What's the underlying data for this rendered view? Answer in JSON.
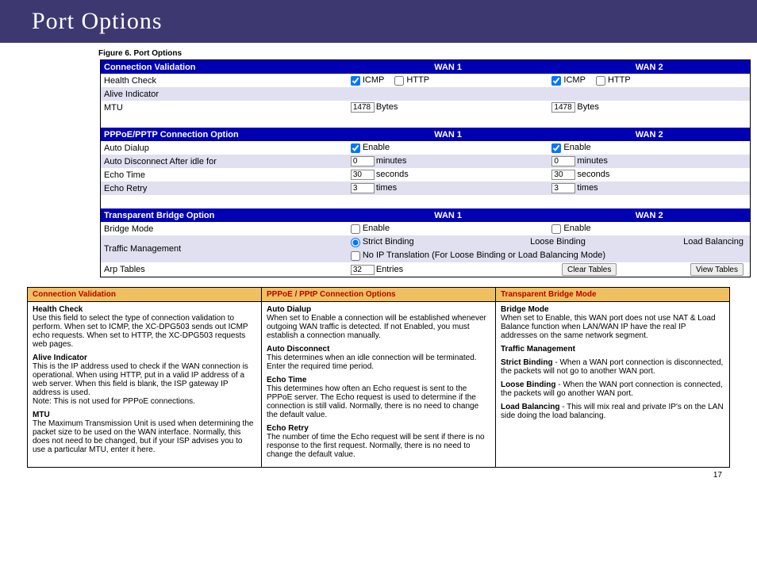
{
  "header": {
    "title": "Port Options"
  },
  "figure_caption": "Figure 6.  Port Options",
  "section1": {
    "title": "Connection Validation",
    "wan1": "WAN 1",
    "wan2": "WAN 2",
    "rows": {
      "health_check": {
        "label": "Health Check",
        "icmp": "ICMP",
        "http": "HTTP",
        "icmp_checked": true,
        "http_checked": false
      },
      "alive_indicator": {
        "label": "Alive Indicator"
      },
      "mtu": {
        "label": "MTU",
        "value": "1478",
        "unit": "Bytes"
      }
    }
  },
  "section2": {
    "title": "PPPoE/PPTP Connection Option",
    "wan1": "WAN 1",
    "wan2": "WAN 2",
    "rows": {
      "auto_dialup": {
        "label": "Auto Dialup",
        "enable": "Enable",
        "checked": true
      },
      "auto_disconnect": {
        "label": "Auto Disconnect After idle for",
        "value": "0",
        "unit": "minutes"
      },
      "echo_time": {
        "label": "Echo Time",
        "value": "30",
        "unit": "seconds"
      },
      "echo_retry": {
        "label": "Echo Retry",
        "value": "3",
        "unit": "times"
      }
    }
  },
  "section3": {
    "title": "Transparent Bridge Option",
    "wan1": "WAN 1",
    "wan2": "WAN 2",
    "rows": {
      "bridge_mode": {
        "label": "Bridge Mode",
        "enable": "Enable",
        "checked": false
      },
      "traffic_mgmt": {
        "label": "Traffic Management",
        "strict": "Strict Binding",
        "loose": "Loose Binding",
        "balance": "Load Balancing",
        "noip": "No IP Translation (For Loose Binding or Load Balancing Mode)",
        "noip_checked": false
      },
      "arp_tables": {
        "label": "Arp Tables",
        "value": "32",
        "unit": "Entries",
        "clear_btn": "Clear Tables",
        "view_btn": "View Tables"
      }
    }
  },
  "descriptions": {
    "col1": {
      "head": "Connection Validation",
      "health_check_t": "Health Check",
      "health_check_b": "Use this field to select the type of connection validation to perform. When set to ICMP, the XC-DPG503 sends out ICMP echo requests.  When set to HTTP, the XC-DPG503 requests web pages.",
      "alive_t": "Alive Indicator",
      "alive_b": "This is the IP address used to check if the WAN connection is operational. When using HTTP, put in a valid IP address of a web server. When this field is blank, the ISP gateway IP address is used.\nNote: This is not used for PPPoE connections.",
      "mtu_t": "MTU",
      "mtu_b": "The Maximum Transmission Unit is used when determining the packet size to be used on the WAN interface. Normally, this does not need to be changed, but if your ISP advises you to use a particular MTU, enter it here."
    },
    "col2": {
      "head": "PPPoE / PPtP Connection Options",
      "ad_t": "Auto Dialup",
      "ad_b": "When set to Enable a connection will be established whenever outgoing WAN traffic is detected. If not Enabled, you must establish a connection manually.",
      "adis_t": "Auto Disconnect",
      "adis_b": "This determines when an idle connection will be terminated. Enter the required time period.",
      "et_t": "Echo Time",
      "et_b": "This determines how often an Echo request is sent to the PPPoE server. The Echo request is used to determine if the connection is still valid. Normally, there is no need to change the default value.",
      "er_t": "Echo Retry",
      "er_b": "The number of time the Echo request will be sent if there is no response to the first request. Normally, there is no need to change the default value."
    },
    "col3": {
      "head": "Transparent Bridge Mode",
      "bm_t": "Bridge Mode",
      "bm_b": "When set to Enable, this WAN port does not use NAT & Load Balance function when LAN/WAN IP have the real IP addresses on the same network segment.",
      "tm_t": "Traffic Management",
      "sb_l": "Strict Binding",
      "sb_b": " - When a WAN port connection is disconnected, the packets will not go to another WAN port.",
      "lb_l": "Loose Binding",
      "lb_b": " - When the WAN port connection is connected, the packets will go another WAN port.",
      "ldb_l": "Load Balancing",
      "ldb_b": " - This will mix real and private IP's on the LAN side doing the load balancing."
    }
  },
  "page_number": "17"
}
